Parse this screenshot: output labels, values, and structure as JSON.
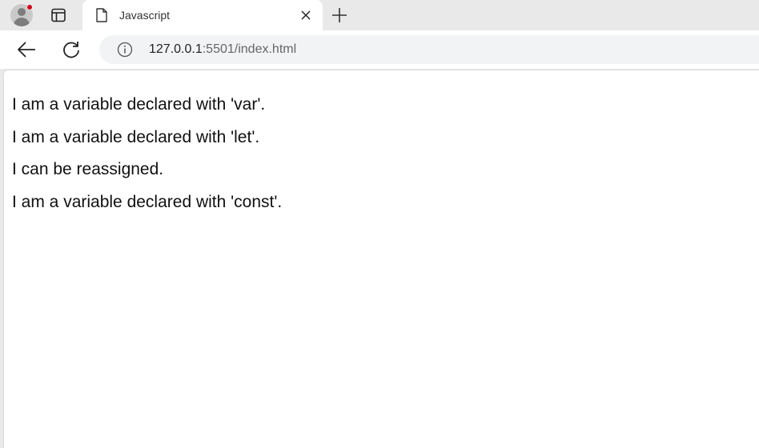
{
  "browser": {
    "tab": {
      "title": "Javascript"
    },
    "address_bar": {
      "host": "127.0.0.1",
      "rest": ":5501/index.html"
    },
    "icons": {
      "profile": "profile-avatar-icon",
      "tab_actions": "tab-actions-icon",
      "favicon": "document-icon",
      "close": "close-icon",
      "new_tab": "plus-icon",
      "back": "back-arrow-icon",
      "reload": "reload-icon",
      "info": "info-icon"
    },
    "colors": {
      "profile_notification": "#d0021b"
    }
  },
  "page": {
    "lines": [
      "I am a variable declared with 'var'.",
      "I am a variable declared with 'let'.",
      "I can be reassigned.",
      "I am a variable declared with 'const'."
    ]
  }
}
